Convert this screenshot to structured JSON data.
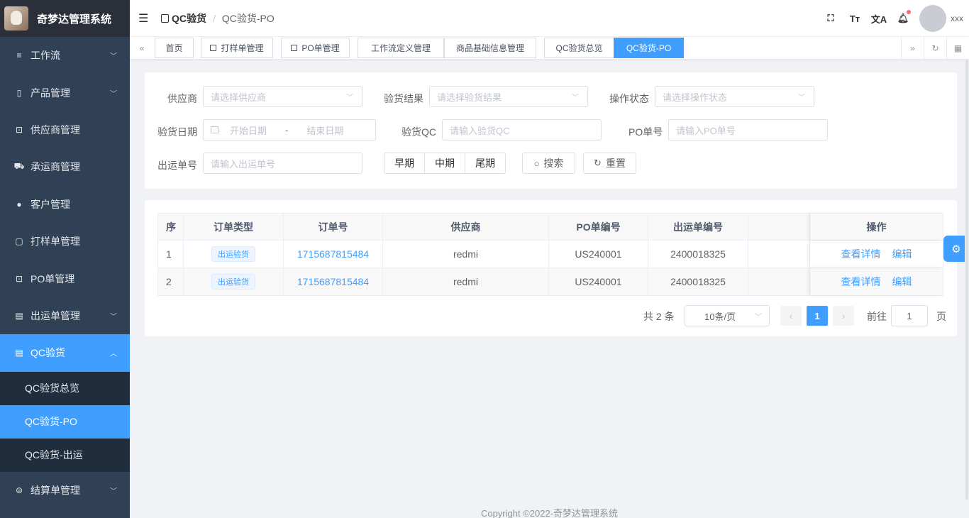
{
  "app": {
    "title": "奇梦达管理系统"
  },
  "sidebar": {
    "items": [
      {
        "label": "工作流",
        "icon": "≡"
      },
      {
        "label": "产品管理",
        "icon": "▯"
      },
      {
        "label": "供应商管理",
        "icon": "⊡"
      },
      {
        "label": "承运商管理",
        "icon": "⛟"
      },
      {
        "label": "客户管理",
        "icon": "●"
      },
      {
        "label": "打样单管理",
        "icon": "▢"
      },
      {
        "label": "PO单管理",
        "icon": "⊡"
      },
      {
        "label": "出运单管理",
        "icon": "▤"
      },
      {
        "label": "QC验货",
        "icon": "▤"
      },
      {
        "label": "结算单管理",
        "icon": "⊜"
      }
    ],
    "qc_children": [
      {
        "label": "QC验货总览"
      },
      {
        "label": "QC验货-PO"
      },
      {
        "label": "QC验货-出运"
      }
    ]
  },
  "header": {
    "breadcrumb": {
      "parent": "QC验货",
      "separator": "/",
      "current": "QC验货-PO"
    },
    "user": "xxx"
  },
  "tags": {
    "items": [
      "首页",
      "打样单管理",
      "PO单管理",
      "工作流定义管理",
      "商品基础信息管理",
      "QC验货总览",
      "QC验货-PO"
    ]
  },
  "search": {
    "supplier": {
      "label": "供应商",
      "placeholder": "请选择供应商"
    },
    "result": {
      "label": "验货结果",
      "placeholder": "请选择验货结果"
    },
    "op_status": {
      "label": "操作状态",
      "placeholder": "请选择操作状态"
    },
    "date": {
      "label": "验货日期",
      "start": "开始日期",
      "sep": "-",
      "end": "结束日期"
    },
    "qc": {
      "label": "验货QC",
      "placeholder": "请输入验货QC"
    },
    "po": {
      "label": "PO单号",
      "placeholder": "请输入PO单号"
    },
    "ship": {
      "label": "出运单号",
      "placeholder": "请输入出运单号"
    },
    "phases": [
      "早期",
      "中期",
      "尾期"
    ],
    "search_btn": "搜索",
    "reset_btn": "重置"
  },
  "table": {
    "columns": [
      "序",
      "订单类型",
      "订单号",
      "供应商",
      "PO单编号",
      "出运单编号",
      "",
      "操作"
    ],
    "rows": [
      {
        "idx": "1",
        "type": "出运验货",
        "order": "1715687815484",
        "supplier": "redmi",
        "po": "US240001",
        "ship": "2400018325",
        "view": "查看详情",
        "edit": "编辑"
      },
      {
        "idx": "2",
        "type": "出运验货",
        "order": "1715687815484",
        "supplier": "redmi",
        "po": "US240001",
        "ship": "2400018325",
        "view": "查看详情",
        "edit": "编辑"
      }
    ]
  },
  "pagination": {
    "total": "共 2 条",
    "page_size": "10条/页",
    "current": "1",
    "goto": "前往",
    "goto_value": "1",
    "page_suffix": "页"
  },
  "footer": {
    "copyright": "Copyright ©2022-奇梦达管理系统"
  },
  "colors": {
    "primary": "#409eff",
    "sidebar": "#304156",
    "submenu": "#1f2d3d"
  }
}
